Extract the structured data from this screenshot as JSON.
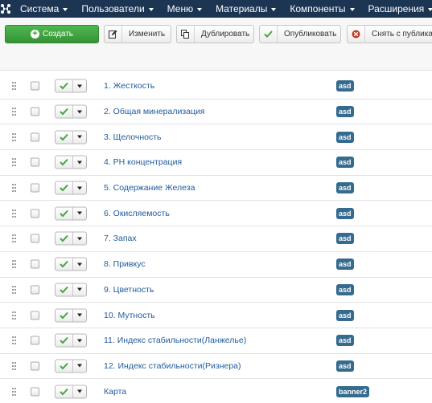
{
  "navbar": {
    "menu": [
      {
        "label": "Система"
      },
      {
        "label": "Пользователи"
      },
      {
        "label": "Меню"
      },
      {
        "label": "Материалы"
      },
      {
        "label": "Компоненты"
      },
      {
        "label": "Расширения"
      }
    ]
  },
  "toolbar": {
    "create_label": "Создать",
    "edit_label": "Изменить",
    "duplicate_label": "Дублировать",
    "publish_label": "Опубликовать",
    "unpublish_label": "Снять с публика"
  },
  "items": [
    {
      "title": "1. Жесткость",
      "category": "asd"
    },
    {
      "title": "2. Общая минерализация",
      "category": "asd"
    },
    {
      "title": "3. Щелочность",
      "category": "asd"
    },
    {
      "title": "4. PH концентрация",
      "category": "asd"
    },
    {
      "title": "5. Содержание Железа",
      "category": "asd"
    },
    {
      "title": "6. Окисляемость",
      "category": "asd"
    },
    {
      "title": "7. Запах",
      "category": "asd"
    },
    {
      "title": "8. Привкус",
      "category": "asd"
    },
    {
      "title": "9. Цветность",
      "category": "asd"
    },
    {
      "title": "10. Мутность",
      "category": "asd"
    },
    {
      "title": "11. Индекс стабильности(Ланжелье)",
      "category": "asd"
    },
    {
      "title": "12. Индекс стабильности(Ризнера)",
      "category": "asd"
    },
    {
      "title": "Карта",
      "category": "banner2"
    }
  ],
  "colors": {
    "navbar": "#1b3553",
    "create_button": "#3a9a3a",
    "link": "#1f5b9c",
    "badge": "#346b8f",
    "check": "#46a546"
  }
}
